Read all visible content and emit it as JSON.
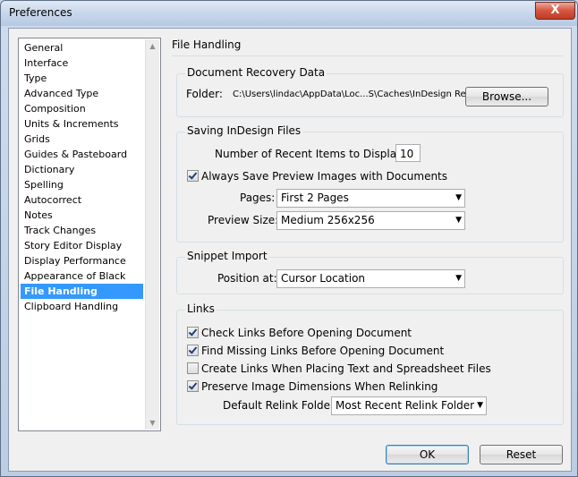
{
  "window": {
    "title": "Preferences",
    "close_label": "X"
  },
  "categories": [
    {
      "label": "General"
    },
    {
      "label": "Interface"
    },
    {
      "label": "Type"
    },
    {
      "label": "Advanced Type"
    },
    {
      "label": "Composition"
    },
    {
      "label": "Units & Increments"
    },
    {
      "label": "Grids"
    },
    {
      "label": "Guides & Pasteboard"
    },
    {
      "label": "Dictionary"
    },
    {
      "label": "Spelling"
    },
    {
      "label": "Autocorrect"
    },
    {
      "label": "Notes"
    },
    {
      "label": "Track Changes"
    },
    {
      "label": "Story Editor Display"
    },
    {
      "label": "Display Performance"
    },
    {
      "label": "Appearance of Black"
    },
    {
      "label": "File Handling",
      "selected": true
    },
    {
      "label": "Clipboard Handling"
    }
  ],
  "panel": {
    "title": "File Handling",
    "recovery": {
      "heading": "Document Recovery Data",
      "folder_label": "Folder:",
      "folder_path": "C:\\Users\\lindac\\AppData\\Loc...S\\Caches\\InDesign Recovery",
      "browse_label": "Browse..."
    },
    "saving": {
      "heading": "Saving InDesign Files",
      "recent_label": "Number of Recent Items to Display:",
      "recent_value": "10",
      "save_preview_label": "Always Save Preview Images with Documents",
      "save_preview_checked": true,
      "pages_label": "Pages:",
      "pages_value": "First 2 Pages",
      "preview_size_label": "Preview Size:",
      "preview_size_value": "Medium 256x256"
    },
    "snippet": {
      "heading": "Snippet Import",
      "position_label": "Position at:",
      "position_value": "Cursor Location"
    },
    "links": {
      "heading": "Links",
      "options": [
        {
          "label": "Check Links Before Opening Document",
          "checked": true
        },
        {
          "label": "Find Missing Links Before Opening Document",
          "checked": true
        },
        {
          "label": "Create Links When Placing Text and Spreadsheet Files",
          "checked": false
        },
        {
          "label": "Preserve Image Dimensions When Relinking",
          "checked": true
        }
      ],
      "relink_label": "Default Relink Folder:",
      "relink_value": "Most Recent Relink Folder"
    }
  },
  "footer": {
    "ok_label": "OK",
    "reset_label": "Reset"
  },
  "icons": {
    "dropdown": "chevron-down-icon",
    "scroll_up": "scroll-up-arrow-icon",
    "scroll_down": "scroll-down-arrow-icon"
  }
}
